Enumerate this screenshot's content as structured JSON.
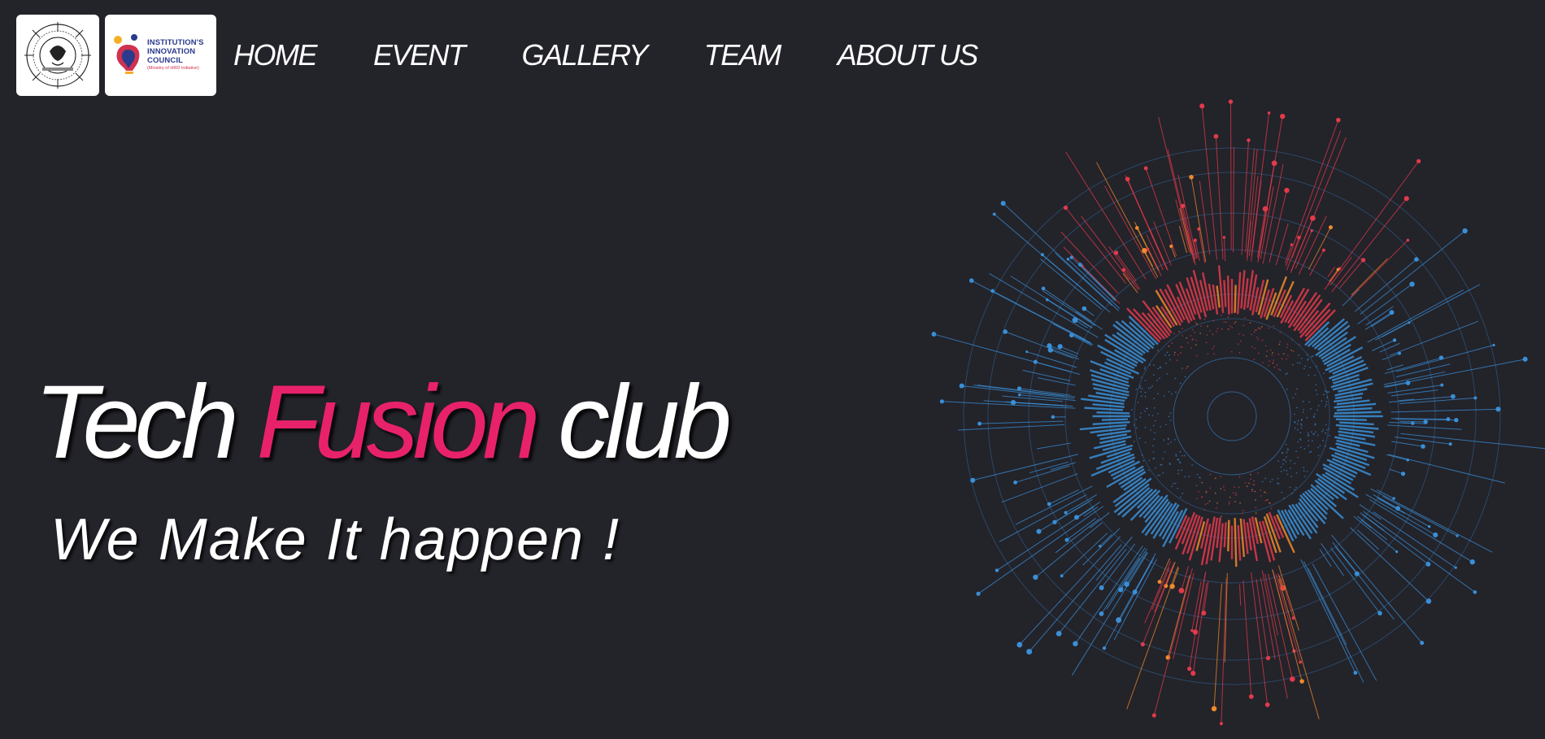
{
  "header": {
    "logos": {
      "club_logo_icon": "club-emblem",
      "iic_logo_icon": "iic-bulb",
      "iic_lines": [
        "INSTITUTION'S",
        "INNOVATION",
        "COUNCIL"
      ],
      "iic_sub": "(Ministry of HRD Initiative)"
    },
    "nav": {
      "home": "HOME",
      "event": "EVENT",
      "gallery": "GALLERY",
      "team": "TEAM",
      "about": "ABOUT US"
    }
  },
  "hero": {
    "title_part1": "Tech",
    "title_part2": "Fusion",
    "title_part3": "club",
    "tagline": "We Make It happen !"
  },
  "theme": {
    "background": "#23232a",
    "accent": "#e8226a",
    "radial_blue": "#3a8fd6",
    "radial_red": "#e23a4a",
    "radial_orange": "#f08a2a"
  }
}
